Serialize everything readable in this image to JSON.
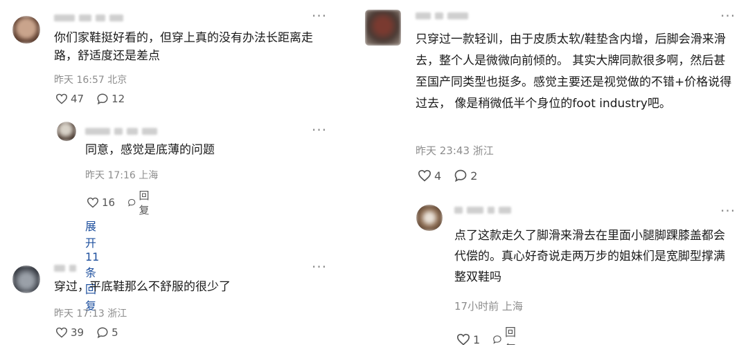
{
  "left": {
    "c1": {
      "text": "你们家鞋挺好看的，但穿上真的没有办法长距离走路，舒适度还是差点",
      "time": "昨天 16:57",
      "loc": "北京",
      "likes": "47",
      "replies": "12"
    },
    "c1_reply": {
      "text": "同意，感觉是底薄的问题",
      "time": "昨天 17:16",
      "loc": "上海",
      "likes": "16",
      "reply_label": "回复",
      "expand_label": "展开 11 条回复"
    },
    "c2": {
      "text": "穿过，平底鞋那么不舒服的很少了",
      "time": "昨天 17:13",
      "loc": "浙江",
      "likes": "39",
      "replies": "5"
    }
  },
  "right": {
    "c1": {
      "text": "只穿过一款轻训，由于皮质太软/鞋垫含内增，后脚会滑来滑去，整个人是微微向前倾的。 其实大牌同款很多啊，然后甚至国产同类型也挺多。感觉主要还是视觉做的不错+价格说得过去， 像是稍微低半个身位的foot industry吧。",
      "time": "昨天 23:43",
      "loc": "浙江",
      "likes": "4",
      "replies": "2"
    },
    "c1_reply": {
      "text": "点了这款走久了脚滑来滑去在里面小腿脚踝膝盖都会代偿的。真心好奇说走两万步的姐妹们是宽脚型撑满整双鞋吗",
      "time": "17小时前",
      "loc": "上海",
      "likes": "1",
      "reply_label": "回复"
    }
  },
  "icons": {
    "more": "more-dots-icon",
    "like": "heart-icon",
    "comment": "comment-bubble-icon"
  },
  "colors": {
    "link": "#1d4f9e",
    "meta": "#8c8c8c"
  }
}
